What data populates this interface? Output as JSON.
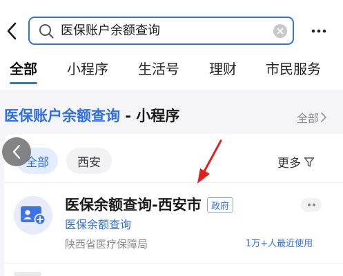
{
  "search": {
    "query": "医保账户余额查询"
  },
  "tabs": [
    {
      "label": "全部",
      "active": true
    },
    {
      "label": "小程序",
      "active": false
    },
    {
      "label": "生活号",
      "active": false
    },
    {
      "label": "理财",
      "active": false
    },
    {
      "label": "市民服务",
      "active": false
    }
  ],
  "section": {
    "title_highlight": "医保账户余额查询",
    "title_rest": " - 小程序",
    "all_label": "全部"
  },
  "filters": {
    "chips": [
      {
        "label": "全部",
        "selected": true
      },
      {
        "label": "西安",
        "selected": false
      }
    ],
    "more_label": "更多"
  },
  "result": {
    "name": "医保余额查询-西安市",
    "badge": "政府",
    "service": "医保余额查询",
    "org": "陕西省医疗保障局",
    "usage": "1万+人最近使用"
  },
  "icons": {
    "back": "chevron-left-icon",
    "search": "search-icon",
    "clear": "clear-icon",
    "more": "more-dots-icon",
    "filter": "filter-icon",
    "app": "id-card-add-icon"
  },
  "colors": {
    "accent": "#2f6fea",
    "annotation_arrow": "#e02020"
  }
}
